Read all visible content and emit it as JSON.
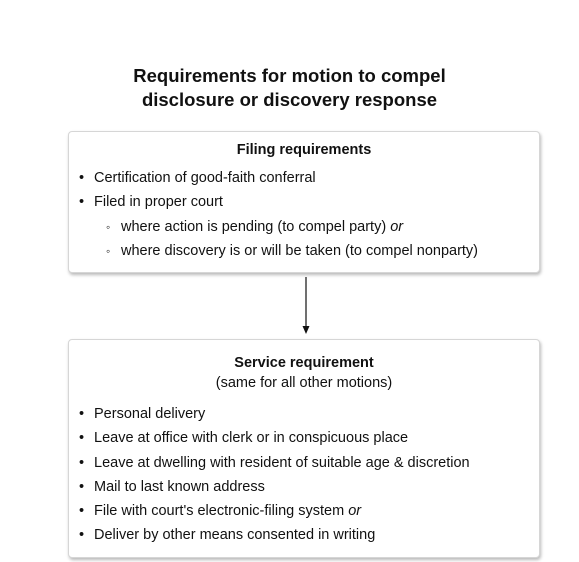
{
  "title_line1": "Requirements for motion to compel",
  "title_line2": "disclosure or discovery response",
  "filing": {
    "heading": "Filing requirements",
    "items": [
      "Certification of good-faith conferral",
      "Filed in proper court"
    ],
    "subitems": [
      {
        "text": "where action is pending (to compel party)",
        "emphasis": "or"
      },
      {
        "text": "where discovery is or will be taken (to compel nonparty)"
      }
    ]
  },
  "service": {
    "heading": "Service requirement",
    "subheading": "(same for all other motions)",
    "items": [
      "Personal delivery",
      "Leave at office with clerk or in conspicuous place",
      "Leave at dwelling with resident of suitable age & discretion",
      "Mail to last known address",
      "File with court's electronic-filing system",
      "Deliver by other means consented in writing"
    ],
    "item5_emphasis": "or"
  },
  "colors": {
    "border": "#d6d6d6",
    "text": "#111111",
    "arrow": "#111111"
  }
}
